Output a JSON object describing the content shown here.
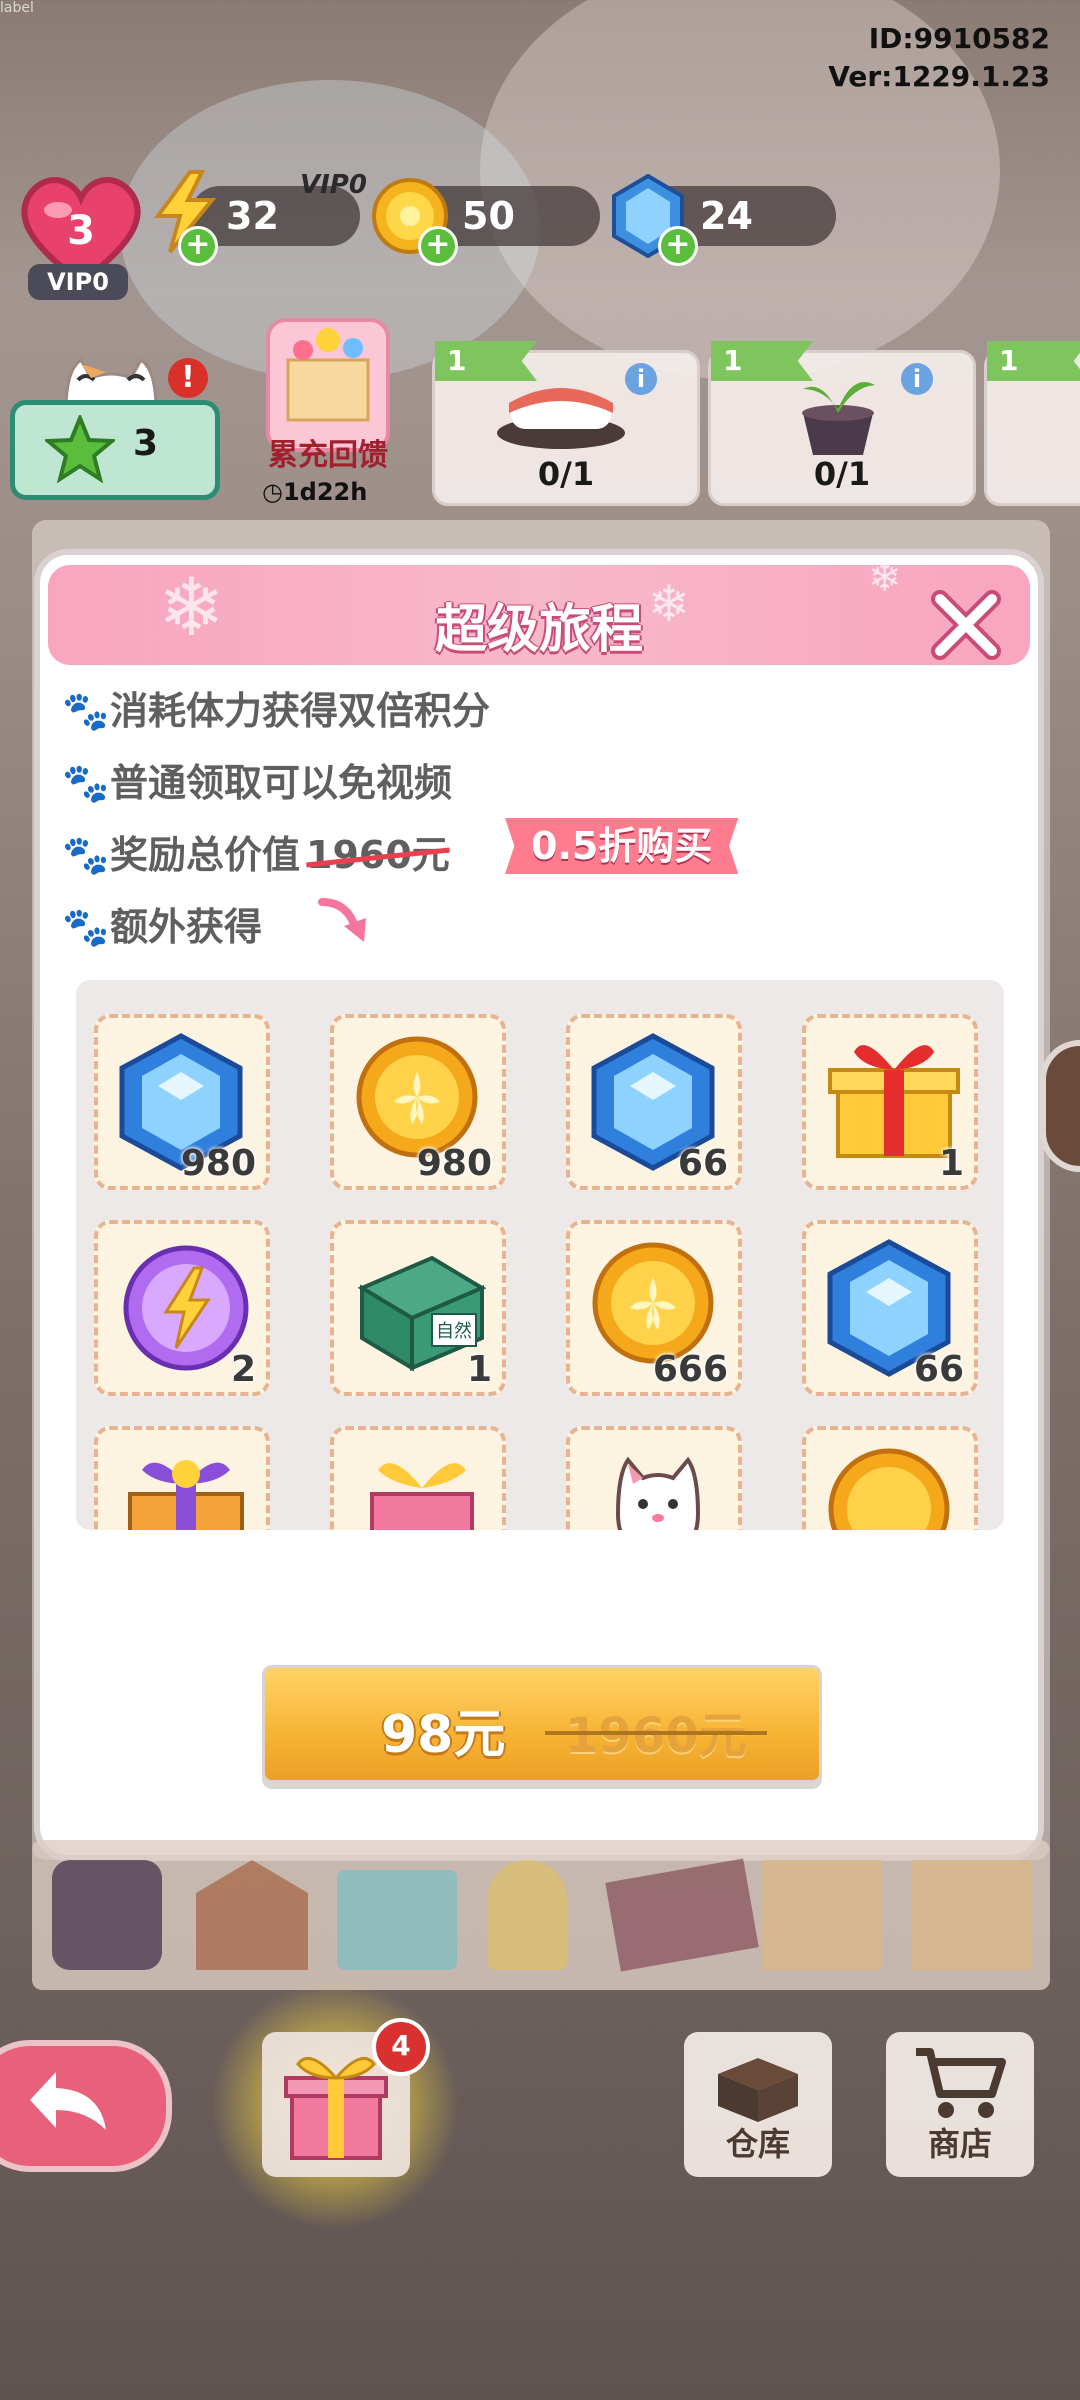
{
  "debug_label": "label",
  "build": {
    "id": "ID:9910582",
    "version": "Ver:1229.1.23"
  },
  "player": {
    "level": "3",
    "vip": "VIP0"
  },
  "resources": {
    "vip_tag": "VIP0",
    "energy": "32",
    "coins": "50",
    "gems": "24"
  },
  "stars": {
    "count": "3"
  },
  "event": {
    "label": "累充回馈",
    "timer": "1d22h"
  },
  "quests": [
    {
      "flag": "1",
      "progress": "0/1"
    },
    {
      "flag": "1",
      "progress": "0/1"
    },
    {
      "flag": "1"
    }
  ],
  "dialog": {
    "title": "超级旅程",
    "bullets": [
      "消耗体力获得双倍积分",
      "普通领取可以免视频",
      "奖励总价值",
      "额外获得"
    ],
    "original_value": "1960元",
    "discount": "0.5折购买",
    "rewards": [
      {
        "item": "gem",
        "qty": "980"
      },
      {
        "item": "coin",
        "qty": "980"
      },
      {
        "item": "gem",
        "qty": "66"
      },
      {
        "item": "gift-box",
        "qty": "1"
      },
      {
        "item": "energy-orb",
        "qty": "2"
      },
      {
        "item": "natural-package",
        "qty": "1",
        "package_text": "自然"
      },
      {
        "item": "coin",
        "qty": "666"
      },
      {
        "item": "gem",
        "qty": "66"
      },
      {
        "item": "purple-gift"
      },
      {
        "item": "pink-gift"
      },
      {
        "item": "lucky-cat"
      },
      {
        "item": "coin"
      }
    ],
    "buy_price": "98元",
    "buy_original": "1960元"
  },
  "bottom": {
    "badge": "4",
    "warehouse": "仓库",
    "shop": "商店"
  }
}
